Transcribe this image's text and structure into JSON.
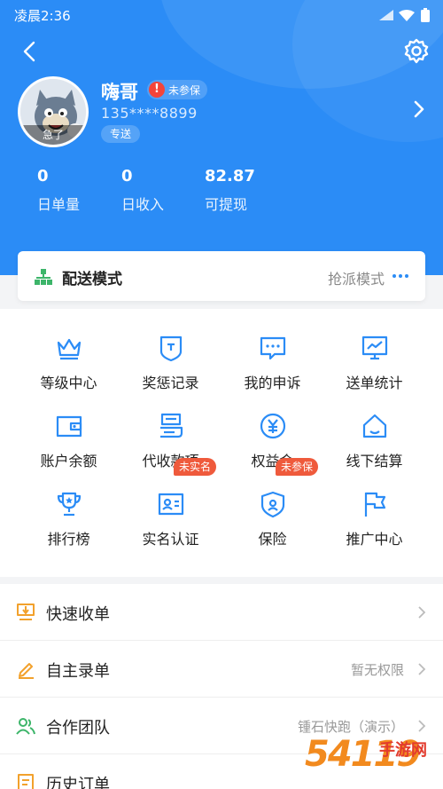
{
  "status_bar": {
    "time": "凌晨2:36"
  },
  "profile": {
    "name": "嗨哥",
    "insurance_status": "未参保",
    "phone": "135****8899",
    "tag": "专送",
    "avatar_caption": "急了"
  },
  "stats": [
    {
      "value": "0",
      "label": "日单量"
    },
    {
      "value": "0",
      "label": "日收入"
    },
    {
      "value": "82.87",
      "label": "可提现"
    }
  ],
  "delivery_mode": {
    "title": "配送模式",
    "value": "抢派模式"
  },
  "grid": [
    {
      "label": "等级中心",
      "icon": "crown-icon",
      "badge": ""
    },
    {
      "label": "奖惩记录",
      "icon": "shield-record-icon",
      "badge": ""
    },
    {
      "label": "我的申诉",
      "icon": "chat-icon",
      "badge": ""
    },
    {
      "label": "送单统计",
      "icon": "chart-board-icon",
      "badge": ""
    },
    {
      "label": "账户余额",
      "icon": "wallet-icon",
      "badge": ""
    },
    {
      "label": "代收款项",
      "icon": "receipt-icon",
      "badge": ""
    },
    {
      "label": "权益金",
      "icon": "yuan-coin-icon",
      "badge": ""
    },
    {
      "label": "线下结算",
      "icon": "home-icon",
      "badge": ""
    },
    {
      "label": "排行榜",
      "icon": "trophy-icon",
      "badge": ""
    },
    {
      "label": "实名认证",
      "icon": "id-card-icon",
      "badge": "未实名"
    },
    {
      "label": "保险",
      "icon": "shield-user-icon",
      "badge": "未参保"
    },
    {
      "label": "推广中心",
      "icon": "flag-icon",
      "badge": ""
    }
  ],
  "list": [
    {
      "label": "快速收单",
      "value": "",
      "icon": "quick-order-icon"
    },
    {
      "label": "自主录单",
      "value": "暂无权限",
      "icon": "edit-icon"
    },
    {
      "label": "合作团队",
      "value": "锺石快跑（演示）",
      "icon": "team-icon"
    },
    {
      "label": "历史订单",
      "value": "",
      "icon": "history-icon"
    }
  ],
  "watermark": {
    "number": "54119",
    "text": "手游网"
  },
  "colors": {
    "header_blue": "#2b8cf6",
    "accent_blue": "#2b8cf6",
    "badge_red": "#ef5a3c",
    "list_icon_orange": "#f2a12c",
    "list_icon_green": "#3db56a"
  }
}
